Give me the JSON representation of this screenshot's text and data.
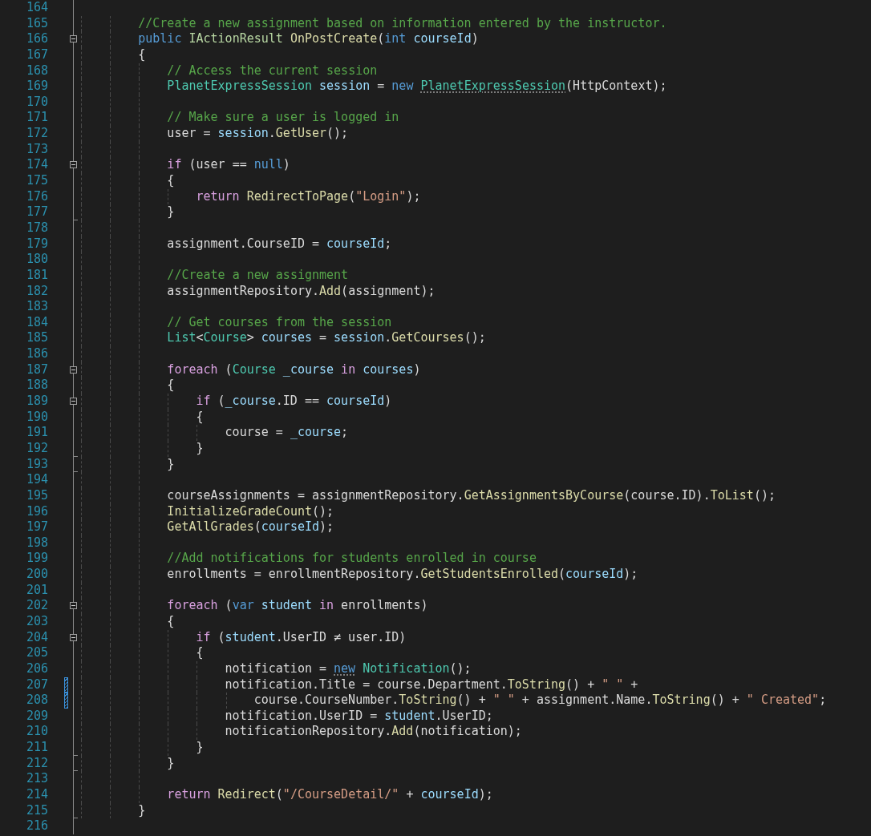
{
  "editor": {
    "lines": [
      {
        "number": "164",
        "changed": false,
        "fold_start": false,
        "fold_end": false
      },
      {
        "number": "165",
        "changed": false,
        "fold_start": false,
        "fold_end": false,
        "code": [
          {
            "kind": "comment",
            "text": "        //Create a new assignment based on information entered by the instructor."
          }
        ]
      },
      {
        "number": "166",
        "changed": false,
        "fold_start": true,
        "fold_end": false,
        "code": [
          {
            "kind": "keyword",
            "text": "        public"
          },
          {
            "kind": "interface",
            "text": " IActionResult"
          },
          {
            "kind": "method",
            "text": " OnPostCreate"
          },
          {
            "kind": "plain",
            "text": "("
          },
          {
            "kind": "keyword",
            "text": "int"
          },
          {
            "kind": "local",
            "text": " courseId"
          },
          {
            "kind": "plain",
            "text": ")"
          }
        ]
      },
      {
        "number": "167",
        "changed": false,
        "fold_start": false,
        "fold_end": false,
        "code": [
          {
            "kind": "plain",
            "text": "        {"
          }
        ]
      },
      {
        "number": "168",
        "changed": false,
        "fold_start": false,
        "fold_end": false,
        "code": [
          {
            "kind": "comment",
            "text": "            // Access the current session"
          }
        ]
      },
      {
        "number": "169",
        "changed": false,
        "fold_start": false,
        "fold_end": false,
        "code": [
          {
            "kind": "type",
            "text": "            PlanetExpressSession"
          },
          {
            "kind": "local",
            "text": " session"
          },
          {
            "kind": "plain",
            "text": " = "
          },
          {
            "kind": "keyword",
            "text": "new "
          },
          {
            "kind": "type",
            "text": "PlanetExpressSession",
            "hint": true
          },
          {
            "kind": "plain",
            "text": "(HttpContext);"
          }
        ]
      },
      {
        "number": "170",
        "changed": false,
        "fold_start": false,
        "fold_end": false
      },
      {
        "number": "171",
        "changed": false,
        "fold_start": false,
        "fold_end": false,
        "code": [
          {
            "kind": "comment",
            "text": "            // Make sure a user is logged in"
          }
        ]
      },
      {
        "number": "172",
        "changed": false,
        "fold_start": false,
        "fold_end": false,
        "code": [
          {
            "kind": "plain",
            "text": "            user = "
          },
          {
            "kind": "local",
            "text": "session"
          },
          {
            "kind": "plain",
            "text": "."
          },
          {
            "kind": "method",
            "text": "GetUser"
          },
          {
            "kind": "plain",
            "text": "();"
          }
        ]
      },
      {
        "number": "173",
        "changed": false,
        "fold_start": false,
        "fold_end": false
      },
      {
        "number": "174",
        "changed": false,
        "fold_start": true,
        "fold_end": false,
        "code": [
          {
            "kind": "control",
            "text": "            if"
          },
          {
            "kind": "plain",
            "text": " (user == "
          },
          {
            "kind": "keyword",
            "text": "null"
          },
          {
            "kind": "plain",
            "text": ")"
          }
        ]
      },
      {
        "number": "175",
        "changed": false,
        "fold_start": false,
        "fold_end": false,
        "code": [
          {
            "kind": "plain",
            "text": "            {"
          }
        ]
      },
      {
        "number": "176",
        "changed": false,
        "fold_start": false,
        "fold_end": false,
        "code": [
          {
            "kind": "control",
            "text": "                return"
          },
          {
            "kind": "method",
            "text": " RedirectToPage"
          },
          {
            "kind": "plain",
            "text": "("
          },
          {
            "kind": "string",
            "text": "\"Login\""
          },
          {
            "kind": "plain",
            "text": ");"
          }
        ]
      },
      {
        "number": "177",
        "changed": false,
        "fold_start": false,
        "fold_end": true,
        "code": [
          {
            "kind": "plain",
            "text": "            }"
          }
        ]
      },
      {
        "number": "178",
        "changed": false,
        "fold_start": false,
        "fold_end": false
      },
      {
        "number": "179",
        "changed": false,
        "fold_start": false,
        "fold_end": false,
        "code": [
          {
            "kind": "plain",
            "text": "            assignment.CourseID = "
          },
          {
            "kind": "local",
            "text": "courseId"
          },
          {
            "kind": "plain",
            "text": ";"
          }
        ]
      },
      {
        "number": "180",
        "changed": false,
        "fold_start": false,
        "fold_end": false
      },
      {
        "number": "181",
        "changed": false,
        "fold_start": false,
        "fold_end": false,
        "code": [
          {
            "kind": "comment",
            "text": "            //Create a new assignment"
          }
        ]
      },
      {
        "number": "182",
        "changed": false,
        "fold_start": false,
        "fold_end": false,
        "code": [
          {
            "kind": "plain",
            "text": "            assignmentRepository."
          },
          {
            "kind": "method",
            "text": "Add"
          },
          {
            "kind": "plain",
            "text": "(assignment);"
          }
        ]
      },
      {
        "number": "183",
        "changed": false,
        "fold_start": false,
        "fold_end": false
      },
      {
        "number": "184",
        "changed": false,
        "fold_start": false,
        "fold_end": false,
        "code": [
          {
            "kind": "comment",
            "text": "            // Get courses from the session"
          }
        ]
      },
      {
        "number": "185",
        "changed": false,
        "fold_start": false,
        "fold_end": false,
        "code": [
          {
            "kind": "type",
            "text": "            List"
          },
          {
            "kind": "plain",
            "text": "<"
          },
          {
            "kind": "type",
            "text": "Course"
          },
          {
            "kind": "plain",
            "text": "> "
          },
          {
            "kind": "local",
            "text": "courses"
          },
          {
            "kind": "plain",
            "text": " = "
          },
          {
            "kind": "local",
            "text": "session"
          },
          {
            "kind": "plain",
            "text": "."
          },
          {
            "kind": "method",
            "text": "GetCourses"
          },
          {
            "kind": "plain",
            "text": "();"
          }
        ]
      },
      {
        "number": "186",
        "changed": false,
        "fold_start": false,
        "fold_end": false
      },
      {
        "number": "187",
        "changed": false,
        "fold_start": true,
        "fold_end": false,
        "code": [
          {
            "kind": "control",
            "text": "            foreach"
          },
          {
            "kind": "plain",
            "text": " ("
          },
          {
            "kind": "type",
            "text": "Course"
          },
          {
            "kind": "local",
            "text": " _course"
          },
          {
            "kind": "control",
            "text": " in"
          },
          {
            "kind": "local",
            "text": " courses"
          },
          {
            "kind": "plain",
            "text": ")"
          }
        ]
      },
      {
        "number": "188",
        "changed": false,
        "fold_start": false,
        "fold_end": false,
        "code": [
          {
            "kind": "plain",
            "text": "            {"
          }
        ]
      },
      {
        "number": "189",
        "changed": false,
        "fold_start": true,
        "fold_end": false,
        "code": [
          {
            "kind": "control",
            "text": "                if"
          },
          {
            "kind": "plain",
            "text": " ("
          },
          {
            "kind": "local",
            "text": "_course"
          },
          {
            "kind": "plain",
            "text": ".ID == "
          },
          {
            "kind": "local",
            "text": "courseId"
          },
          {
            "kind": "plain",
            "text": ")"
          }
        ]
      },
      {
        "number": "190",
        "changed": false,
        "fold_start": false,
        "fold_end": false,
        "code": [
          {
            "kind": "plain",
            "text": "                {"
          }
        ]
      },
      {
        "number": "191",
        "changed": false,
        "fold_start": false,
        "fold_end": false,
        "code": [
          {
            "kind": "plain",
            "text": "                    course = "
          },
          {
            "kind": "local",
            "text": "_course"
          },
          {
            "kind": "plain",
            "text": ";"
          }
        ]
      },
      {
        "number": "192",
        "changed": false,
        "fold_start": false,
        "fold_end": true,
        "code": [
          {
            "kind": "plain",
            "text": "                }"
          }
        ]
      },
      {
        "number": "193",
        "changed": false,
        "fold_start": false,
        "fold_end": true,
        "code": [
          {
            "kind": "plain",
            "text": "            }"
          }
        ]
      },
      {
        "number": "194",
        "changed": false,
        "fold_start": false,
        "fold_end": false
      },
      {
        "number": "195",
        "changed": false,
        "fold_start": false,
        "fold_end": false,
        "code": [
          {
            "kind": "plain",
            "text": "            courseAssignments = assignmentRepository."
          },
          {
            "kind": "method",
            "text": "GetAssignmentsByCourse"
          },
          {
            "kind": "plain",
            "text": "(course.ID)."
          },
          {
            "kind": "method",
            "text": "ToList"
          },
          {
            "kind": "plain",
            "text": "();"
          }
        ]
      },
      {
        "number": "196",
        "changed": false,
        "fold_start": false,
        "fold_end": false,
        "code": [
          {
            "kind": "method",
            "text": "            InitializeGradeCount"
          },
          {
            "kind": "plain",
            "text": "();"
          }
        ]
      },
      {
        "number": "197",
        "changed": false,
        "fold_start": false,
        "fold_end": false,
        "code": [
          {
            "kind": "method",
            "text": "            GetAllGrades"
          },
          {
            "kind": "plain",
            "text": "("
          },
          {
            "kind": "local",
            "text": "courseId"
          },
          {
            "kind": "plain",
            "text": ");"
          }
        ]
      },
      {
        "number": "198",
        "changed": false,
        "fold_start": false,
        "fold_end": false
      },
      {
        "number": "199",
        "changed": false,
        "fold_start": false,
        "fold_end": false,
        "code": [
          {
            "kind": "comment",
            "text": "            //Add notifications for students enrolled in course"
          }
        ]
      },
      {
        "number": "200",
        "changed": false,
        "fold_start": false,
        "fold_end": false,
        "code": [
          {
            "kind": "plain",
            "text": "            enrollments = enrollmentRepository."
          },
          {
            "kind": "method",
            "text": "GetStudentsEnrolled"
          },
          {
            "kind": "plain",
            "text": "("
          },
          {
            "kind": "local",
            "text": "courseId"
          },
          {
            "kind": "plain",
            "text": ");"
          }
        ]
      },
      {
        "number": "201",
        "changed": false,
        "fold_start": false,
        "fold_end": false
      },
      {
        "number": "202",
        "changed": false,
        "fold_start": true,
        "fold_end": false,
        "code": [
          {
            "kind": "control",
            "text": "            foreach"
          },
          {
            "kind": "plain",
            "text": " ("
          },
          {
            "kind": "keyword",
            "text": "var"
          },
          {
            "kind": "local",
            "text": " student"
          },
          {
            "kind": "control",
            "text": " in"
          },
          {
            "kind": "plain",
            "text": " enrollments)"
          }
        ]
      },
      {
        "number": "203",
        "changed": false,
        "fold_start": false,
        "fold_end": false,
        "code": [
          {
            "kind": "plain",
            "text": "            {"
          }
        ]
      },
      {
        "number": "204",
        "changed": false,
        "fold_start": true,
        "fold_end": false,
        "code": [
          {
            "kind": "control",
            "text": "                if"
          },
          {
            "kind": "plain",
            "text": " ("
          },
          {
            "kind": "local",
            "text": "student"
          },
          {
            "kind": "plain",
            "text": ".UserID ≠ user.ID)"
          }
        ]
      },
      {
        "number": "205",
        "changed": false,
        "fold_start": false,
        "fold_end": false,
        "code": [
          {
            "kind": "plain",
            "text": "                {"
          }
        ]
      },
      {
        "number": "206",
        "changed": false,
        "fold_start": false,
        "fold_end": false,
        "code": [
          {
            "kind": "plain",
            "text": "                    notification = "
          },
          {
            "kind": "keyword",
            "text": "new",
            "hint": true
          },
          {
            "kind": "type",
            "text": " Notification"
          },
          {
            "kind": "plain",
            "text": "();"
          }
        ]
      },
      {
        "number": "207",
        "changed": true,
        "fold_start": false,
        "fold_end": false,
        "code": [
          {
            "kind": "plain",
            "text": "                    notification.Title = course.Department."
          },
          {
            "kind": "method",
            "text": "ToString"
          },
          {
            "kind": "plain",
            "text": "() + "
          },
          {
            "kind": "string",
            "text": "\" \""
          },
          {
            "kind": "plain",
            "text": " +"
          }
        ]
      },
      {
        "number": "208",
        "changed": true,
        "fold_start": false,
        "fold_end": false,
        "code": [
          {
            "kind": "plain",
            "text": "                        course.CourseNumber."
          },
          {
            "kind": "method",
            "text": "ToString"
          },
          {
            "kind": "plain",
            "text": "() + "
          },
          {
            "kind": "string",
            "text": "\" \""
          },
          {
            "kind": "plain",
            "text": " + assignment.Name."
          },
          {
            "kind": "method",
            "text": "ToString"
          },
          {
            "kind": "plain",
            "text": "() + "
          },
          {
            "kind": "string",
            "text": "\" Created\""
          },
          {
            "kind": "plain",
            "text": ";"
          }
        ]
      },
      {
        "number": "209",
        "changed": false,
        "fold_start": false,
        "fold_end": false,
        "code": [
          {
            "kind": "plain",
            "text": "                    notification.UserID = "
          },
          {
            "kind": "local",
            "text": "student"
          },
          {
            "kind": "plain",
            "text": ".UserID;"
          }
        ]
      },
      {
        "number": "210",
        "changed": false,
        "fold_start": false,
        "fold_end": false,
        "code": [
          {
            "kind": "plain",
            "text": "                    notificationRepository."
          },
          {
            "kind": "method",
            "text": "Add"
          },
          {
            "kind": "plain",
            "text": "(notification);"
          }
        ]
      },
      {
        "number": "211",
        "changed": false,
        "fold_start": false,
        "fold_end": true,
        "code": [
          {
            "kind": "plain",
            "text": "                }"
          }
        ]
      },
      {
        "number": "212",
        "changed": false,
        "fold_start": false,
        "fold_end": true,
        "code": [
          {
            "kind": "plain",
            "text": "            }"
          }
        ]
      },
      {
        "number": "213",
        "changed": false,
        "fold_start": false,
        "fold_end": false
      },
      {
        "number": "214",
        "changed": false,
        "fold_start": false,
        "fold_end": false,
        "code": [
          {
            "kind": "control",
            "text": "            return"
          },
          {
            "kind": "method",
            "text": " Redirect"
          },
          {
            "kind": "plain",
            "text": "("
          },
          {
            "kind": "string",
            "text": "\"/CourseDetail/\""
          },
          {
            "kind": "plain",
            "text": " + "
          },
          {
            "kind": "local",
            "text": "courseId"
          },
          {
            "kind": "plain",
            "text": ");"
          }
        ]
      },
      {
        "number": "215",
        "changed": false,
        "fold_start": false,
        "fold_end": true,
        "code": [
          {
            "kind": "plain",
            "text": "        }"
          }
        ]
      },
      {
        "number": "216",
        "changed": false,
        "fold_start": false,
        "fold_end": false
      }
    ]
  }
}
